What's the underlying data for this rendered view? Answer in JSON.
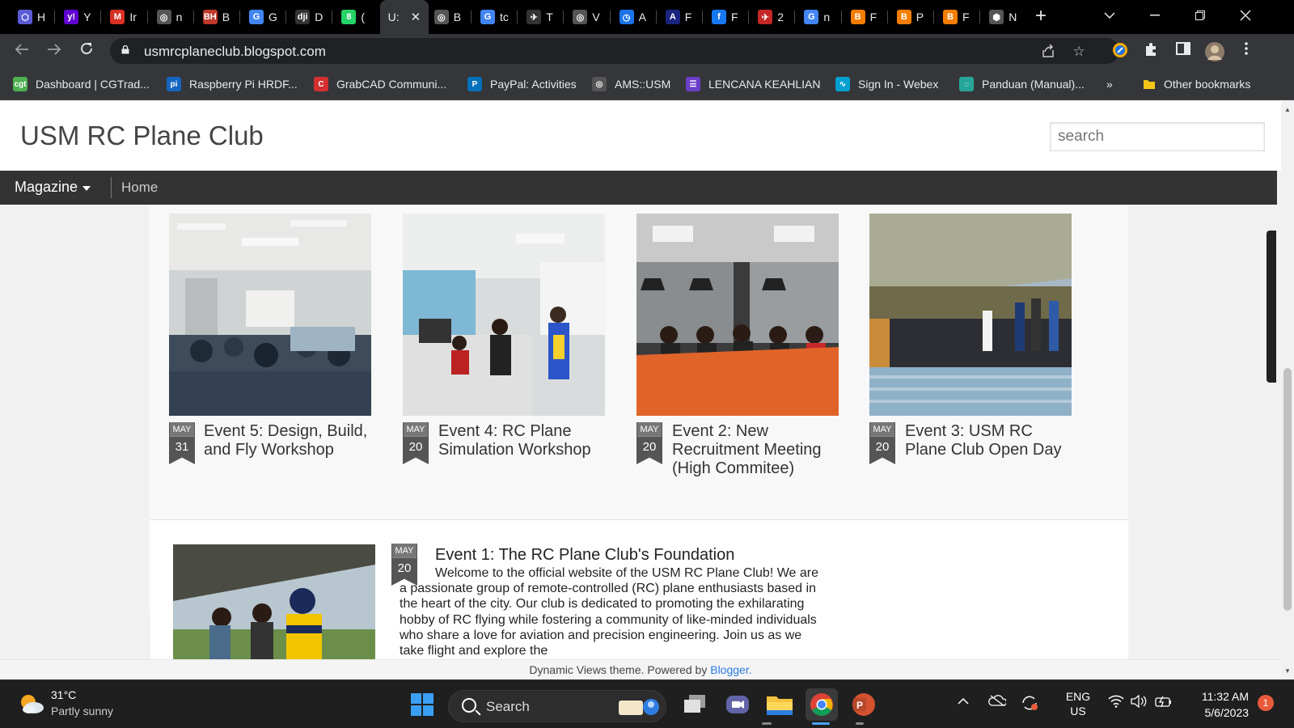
{
  "browser": {
    "tabs": [
      {
        "short": "H",
        "fav": "⬡",
        "color": "#5b5bd6"
      },
      {
        "short": "Y",
        "fav": "y!",
        "color": "#6001d2"
      },
      {
        "short": "Ir",
        "fav": "M",
        "color": "#d93025"
      },
      {
        "short": "n",
        "fav": "◎",
        "color": "#555"
      },
      {
        "short": "B",
        "fav": "BH",
        "color": "#c0392b"
      },
      {
        "short": "G",
        "fav": "G",
        "color": "#4285f4"
      },
      {
        "short": "D",
        "fav": "dji",
        "color": "#333"
      },
      {
        "short": "(",
        "fav": "8",
        "color": "#25d366"
      },
      {
        "short": "U:",
        "fav": "",
        "color": "#35363a"
      },
      {
        "short": "B",
        "fav": "◎",
        "color": "#555"
      },
      {
        "short": "tc",
        "fav": "G",
        "color": "#4285f4"
      },
      {
        "short": "T",
        "fav": "✈",
        "color": "#333"
      },
      {
        "short": "V",
        "fav": "◎",
        "color": "#555"
      },
      {
        "short": "A",
        "fav": "◷",
        "color": "#1a73e8"
      },
      {
        "short": "F",
        "fav": "A",
        "color": "#1a237e"
      },
      {
        "short": "F",
        "fav": "f",
        "color": "#1877f2"
      },
      {
        "short": "2",
        "fav": "✈",
        "color": "#c62828"
      },
      {
        "short": "n",
        "fav": "G",
        "color": "#4285f4"
      },
      {
        "short": "F",
        "fav": "B",
        "color": "#f57d00"
      },
      {
        "short": "P",
        "fav": "B",
        "color": "#f57d00"
      },
      {
        "short": "F",
        "fav": "B",
        "color": "#f57d00"
      },
      {
        "short": "N",
        "fav": "⬢",
        "color": "#555"
      }
    ],
    "active_tab_index": 8,
    "url": "usmrcplaneclub.blogspot.com",
    "bookmarks": [
      {
        "label": "Dashboard | CGTrad...",
        "icon": "cgt",
        "color": "#4caf50"
      },
      {
        "label": "Raspberry Pi HRDF...",
        "icon": "pi",
        "color": "#1565c0"
      },
      {
        "label": "GrabCAD Communi...",
        "icon": "C",
        "color": "#d32f2f"
      },
      {
        "label": "PayPal: Activities",
        "icon": "P",
        "color": "#0070ba"
      },
      {
        "label": "AMS::USM",
        "icon": "◎",
        "color": "#555"
      },
      {
        "label": "LENCANA KEAHLIAN",
        "icon": "☰",
        "color": "#6a3fc8"
      },
      {
        "label": "Sign In - Webex",
        "icon": "∿",
        "color": "#00a0d1"
      },
      {
        "label": "Panduan (Manual)...",
        "icon": "◌",
        "color": "#26a69a"
      }
    ],
    "overflow_label": "»",
    "other_bookmarks_label": "Other bookmarks"
  },
  "site": {
    "title": "USM RC Plane Club",
    "search_placeholder": "search",
    "menu_magazine": "Magazine",
    "menu_home": "Home",
    "posts": [
      {
        "month": "MAY",
        "day": "31",
        "title": "Event 5: Design, Build, and Fly Workshop"
      },
      {
        "month": "MAY",
        "day": "20",
        "title": "Event 4: RC Plane Simulation Workshop"
      },
      {
        "month": "MAY",
        "day": "20",
        "title": "Event 2: New Recruitment Meeting (High Commitee)"
      },
      {
        "month": "MAY",
        "day": "20",
        "title": "Event 3: USM RC Plane Club Open Day"
      }
    ],
    "featured": {
      "month": "MAY",
      "day": "20",
      "title": "Event 1: The RC Plane Club's Foundation",
      "body": "Welcome to the official website of the USM RC Plane Club! We are a passionate group of remote-controlled (RC) plane enthusiasts based in the heart of the city. Our club is dedicated to promoting the exhilarating hobby of RC flying while fostering a community of like-minded individuals who share a love for aviation and precision engineering. Join us as we take flight and explore the"
    },
    "footer_text": "Dynamic Views theme. Powered by ",
    "footer_link": "Blogger."
  },
  "taskbar": {
    "weather_temp": "31°C",
    "weather_cond": "Partly sunny",
    "search_label": "Search",
    "lang_line1": "ENG",
    "lang_line2": "US",
    "time": "11:32 AM",
    "date": "5/6/2023",
    "notif_count": "1"
  }
}
